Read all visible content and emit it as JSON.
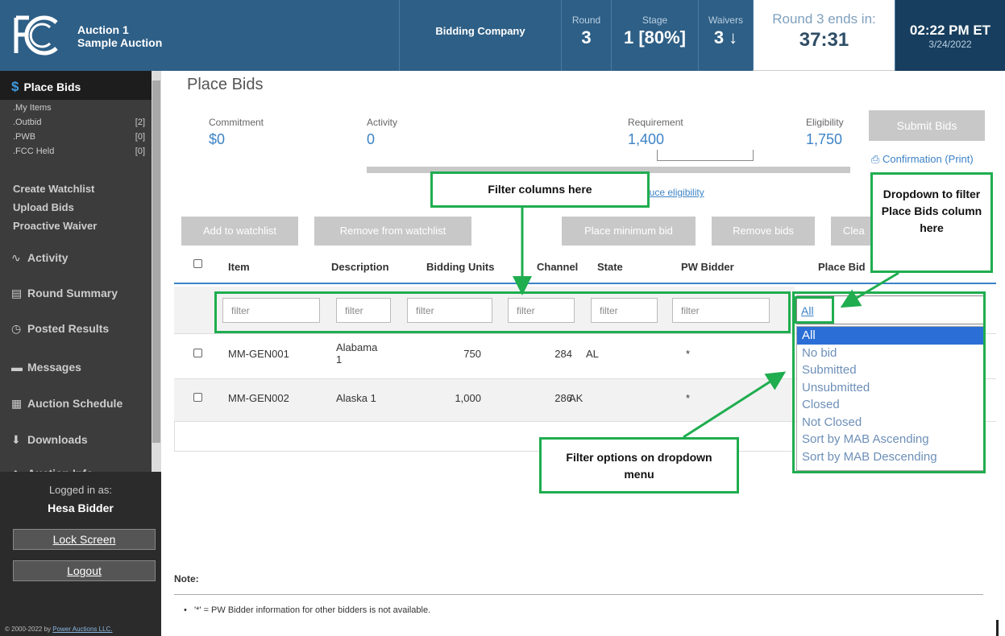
{
  "header": {
    "auction_line1": "Auction 1",
    "auction_line2": "Sample Auction",
    "bidding_company": "Bidding Company",
    "round_label": "Round",
    "round_value": "3",
    "stage_label": "Stage",
    "stage_value": "1 [80%]",
    "waivers_label": "Waivers",
    "waivers_value": "3 ↓",
    "ends_label": "Round 3 ends in:",
    "ends_value": "37:31",
    "time": "02:22 PM ET",
    "date": "3/24/2022"
  },
  "sidebar": {
    "active": "Place Bids",
    "sub_items": [
      {
        "label": ".My Items",
        "count": ""
      },
      {
        "label": ".Outbid",
        "count": "[2]"
      },
      {
        "label": ".PWB",
        "count": "[0]"
      },
      {
        "label": ".FCC Held",
        "count": "[0]"
      }
    ],
    "links": [
      "Create Watchlist",
      "Upload Bids",
      "Proactive Waiver"
    ],
    "main_items": [
      {
        "label": "Activity",
        "icon": "activity-icon"
      },
      {
        "label": "Round Summary",
        "icon": "document-icon"
      },
      {
        "label": "Posted Results",
        "icon": "clock-icon"
      },
      {
        "label": "Messages",
        "icon": "message-icon"
      },
      {
        "label": "Auction Schedule",
        "icon": "calendar-icon"
      },
      {
        "label": "Downloads",
        "icon": "download-icon"
      },
      {
        "label": "Auction Info",
        "icon": "info-icon"
      }
    ],
    "logged_in_as": "Logged in as:",
    "user": "Hesa Bidder",
    "lock_screen": "Lock Screen",
    "logout": "Logout",
    "copyright_prefix": "© 2000-2022 by ",
    "copyright_link": "Power Auctions LLC."
  },
  "main": {
    "title": "Place Bids",
    "metrics": {
      "commitment_label": "Commitment",
      "commitment_value": "$0",
      "activity_label": "Activity",
      "activity_value": "0",
      "requirement_label": "Requirement",
      "requirement_value": "1,400",
      "eligibility_label": "Eligibility",
      "eligibility_value": "1,750"
    },
    "submit_bids": "Submit Bids",
    "confirmation": "Confirmation",
    "print": "(Print)",
    "reduce_eligibility": "duce eligibility",
    "buttons": {
      "add_watchlist": "Add to watchlist",
      "remove_watchlist": "Remove from watchlist",
      "place_min": "Place minimum bid",
      "remove_bids": "Remove bids",
      "clear": "Clea"
    },
    "columns": [
      "Item",
      "Description",
      "Bidding Units",
      "Channel",
      "State",
      "PW Bidder",
      "Place Bid"
    ],
    "filter_placeholder": "filter",
    "rows": [
      {
        "item": "MM-GEN001",
        "description": "Alabama 1",
        "units": "750",
        "channel": "284",
        "state": "AL",
        "pw": "*"
      },
      {
        "item": "MM-GEN002",
        "description": "Alaska 1",
        "units": "1,000",
        "channel": "286",
        "state": "AK",
        "pw": "*"
      }
    ],
    "dropdown_selected": "All",
    "dropdown_options": [
      "All",
      "No bid",
      "Submitted",
      "Unsubmitted",
      "Closed",
      "Not Closed",
      "Sort by MAB Ascending",
      "Sort by MAB Descending"
    ],
    "note_title": "Note:",
    "note_text": "'*' = PW Bidder information for other bidders is not available."
  },
  "annotations": {
    "filter_columns": "Filter columns here",
    "dropdown_place_bids": "Dropdown to filter Place Bids column here",
    "filter_options": "Filter options on dropdown menu"
  },
  "colors": {
    "header_bg": "#2e5f86",
    "accent_blue": "#3c83c6",
    "annotation_green": "#1fad4f",
    "selected_option": "#2b6fd6"
  }
}
